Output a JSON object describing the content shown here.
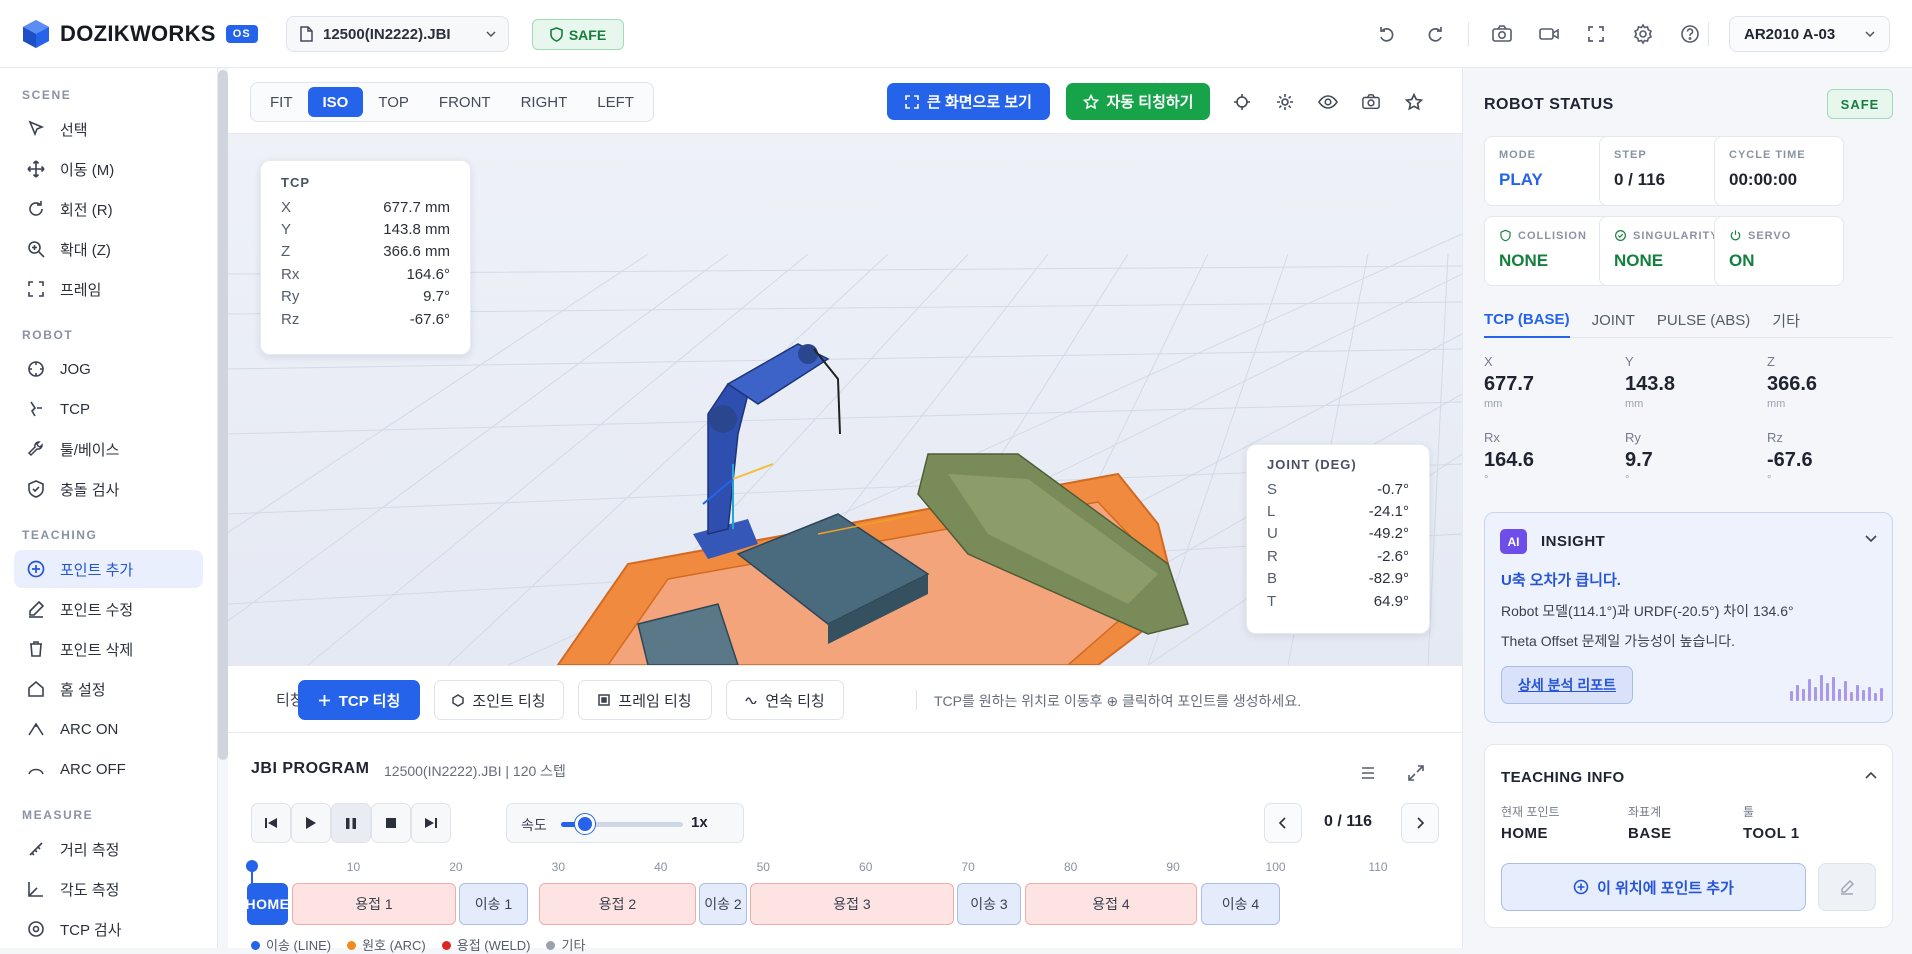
{
  "app": {
    "name": "DOZIKWORKS",
    "badge": "OS"
  },
  "file_select": {
    "value": "12500(IN2222).JBI"
  },
  "status_chip": {
    "label": "SAFE"
  },
  "robot_select": {
    "value": "AR2010 A-03"
  },
  "sidebar": {
    "sections": [
      {
        "title": "SCENE",
        "items": [
          {
            "label": "선택",
            "icon": "cursor-icon"
          },
          {
            "label": "이동 (M)",
            "icon": "move-icon"
          },
          {
            "label": "회전 (R)",
            "icon": "rotate-icon"
          },
          {
            "label": "확대 (Z)",
            "icon": "zoom-icon"
          },
          {
            "label": "프레임",
            "icon": "frame-icon"
          }
        ]
      },
      {
        "title": "ROBOT",
        "items": [
          {
            "label": "JOG",
            "icon": "jog-icon"
          },
          {
            "label": "TCP",
            "icon": "tcp-icon"
          },
          {
            "label": "툴/베이스",
            "icon": "wrench-icon"
          },
          {
            "label": "충돌 검사",
            "icon": "shield-icon"
          }
        ]
      },
      {
        "title": "TEACHING",
        "items": [
          {
            "label": "포인트 추가",
            "icon": "plus-circle-icon",
            "active": true
          },
          {
            "label": "포인트 수정",
            "icon": "edit-icon"
          },
          {
            "label": "포인트 삭제",
            "icon": "trash-icon"
          },
          {
            "label": "홈 설정",
            "icon": "home-icon"
          },
          {
            "label": "ARC ON",
            "icon": "arc-on-icon"
          },
          {
            "label": "ARC OFF",
            "icon": "arc-off-icon"
          }
        ]
      },
      {
        "title": "MEASURE",
        "items": [
          {
            "label": "거리 측정",
            "icon": "ruler-icon"
          },
          {
            "label": "각도 측정",
            "icon": "angle-icon"
          },
          {
            "label": "TCP 검사",
            "icon": "target-icon"
          }
        ]
      }
    ]
  },
  "view_tabs": [
    "FIT",
    "ISO",
    "TOP",
    "FRONT",
    "RIGHT",
    "LEFT"
  ],
  "view_tab_active": "ISO",
  "view_actions": {
    "fullscreen": "큰 화면으로 보기",
    "auto_teach": "자동 티칭하기"
  },
  "tcp_card": {
    "title": "TCP",
    "rows": [
      {
        "k": "X",
        "v": "677.7 mm"
      },
      {
        "k": "Y",
        "v": "143.8 mm"
      },
      {
        "k": "Z",
        "v": "366.6 mm"
      },
      {
        "k": "Rx",
        "v": "164.6°"
      },
      {
        "k": "Ry",
        "v": "9.7°"
      },
      {
        "k": "Rz",
        "v": "-67.6°"
      }
    ]
  },
  "joint_card": {
    "title": "JOINT (DEG)",
    "rows": [
      {
        "k": "S",
        "v": "-0.7°"
      },
      {
        "k": "L",
        "v": "-24.1°"
      },
      {
        "k": "U",
        "v": "-49.2°"
      },
      {
        "k": "R",
        "v": "-2.6°"
      },
      {
        "k": "B",
        "v": "-82.9°"
      },
      {
        "k": "T",
        "v": "64.9°"
      }
    ]
  },
  "teach_bar": {
    "mode_label": "티칭 모드",
    "tcp": "TCP 티칭",
    "joint": "조인트 티칭",
    "frame": "프레임 티칭",
    "continuous": "연속 티칭",
    "hint": "TCP를 원하는 위치로 이동후 ⊕ 클릭하여 포인트를 생성하세요."
  },
  "program": {
    "title": "JBI PROGRAM",
    "subtitle": "12500(IN2222).JBI | 120 스텝",
    "speed_label": "속도",
    "speed_value": "1x",
    "speed_fraction": 0.2,
    "step_counter": "0 / 116",
    "ruler_ticks": [
      "10",
      "20",
      "30",
      "40",
      "50",
      "60",
      "70",
      "80",
      "90",
      "100",
      "110"
    ],
    "segments": [
      {
        "label": "HOME",
        "kind": "home"
      },
      {
        "label": "용접 1",
        "kind": "weld"
      },
      {
        "label": "이송 1",
        "kind": "move"
      },
      {
        "label": "용접 2",
        "kind": "weld"
      },
      {
        "label": "이송 2",
        "kind": "move"
      },
      {
        "label": "용접 3",
        "kind": "weld"
      },
      {
        "label": "이송 3",
        "kind": "move"
      },
      {
        "label": "용접 4",
        "kind": "weld"
      },
      {
        "label": "이송 4",
        "kind": "move"
      }
    ],
    "legend": [
      {
        "label": "이송 (LINE)",
        "color": "#2563eb"
      },
      {
        "label": "원호 (ARC)",
        "color": "#f08a1c"
      },
      {
        "label": "용접 (WELD)",
        "color": "#dc2626"
      },
      {
        "label": "기타",
        "color": "#9aa1ae"
      }
    ]
  },
  "robot_status": {
    "title": "ROBOT STATUS",
    "badge": "SAFE",
    "stats": [
      {
        "label": "MODE",
        "value": "PLAY",
        "style": "blue"
      },
      {
        "label": "STEP",
        "value": "0 / 116",
        "style": ""
      },
      {
        "label": "CYCLE TIME",
        "value": "00:00:00",
        "style": ""
      },
      {
        "label": "COLLISION",
        "value": "NONE",
        "style": "green",
        "icon": "shield-icon"
      },
      {
        "label": "SINGULARITY",
        "value": "NONE",
        "style": "green",
        "icon": "check-circle-icon"
      },
      {
        "label": "SERVO",
        "value": "ON",
        "style": "green",
        "icon": "power-icon"
      }
    ],
    "tabs": [
      "TCP (BASE)",
      "JOINT",
      "PULSE (ABS)",
      "기타"
    ],
    "coords": [
      {
        "k": "X",
        "v": "677.7",
        "u": "mm"
      },
      {
        "k": "Y",
        "v": "143.8",
        "u": "mm"
      },
      {
        "k": "Z",
        "v": "366.6",
        "u": "mm"
      },
      {
        "k": "Rx",
        "v": "164.6",
        "u": "°"
      },
      {
        "k": "Ry",
        "v": "9.7",
        "u": "°"
      },
      {
        "k": "Rz",
        "v": "-67.6",
        "u": "°"
      }
    ]
  },
  "insight": {
    "badge": "AI",
    "title": "INSIGHT",
    "headline": "U축 오차가 큽니다.",
    "line1": "Robot 모델(114.1°)과 URDF(-20.5°) 차이 134.6°",
    "line2": "Theta Offset 문제일 가능성이 높습니다.",
    "button": "상세 분석 리포트"
  },
  "teaching_info": {
    "title": "TEACHING INFO",
    "cols": [
      {
        "k": "현재 포인트",
        "v": "HOME"
      },
      {
        "k": "좌표계",
        "v": "BASE"
      },
      {
        "k": "툴",
        "v": "TOOL 1"
      }
    ],
    "add_button": "이 위치에 포인트 추가"
  }
}
